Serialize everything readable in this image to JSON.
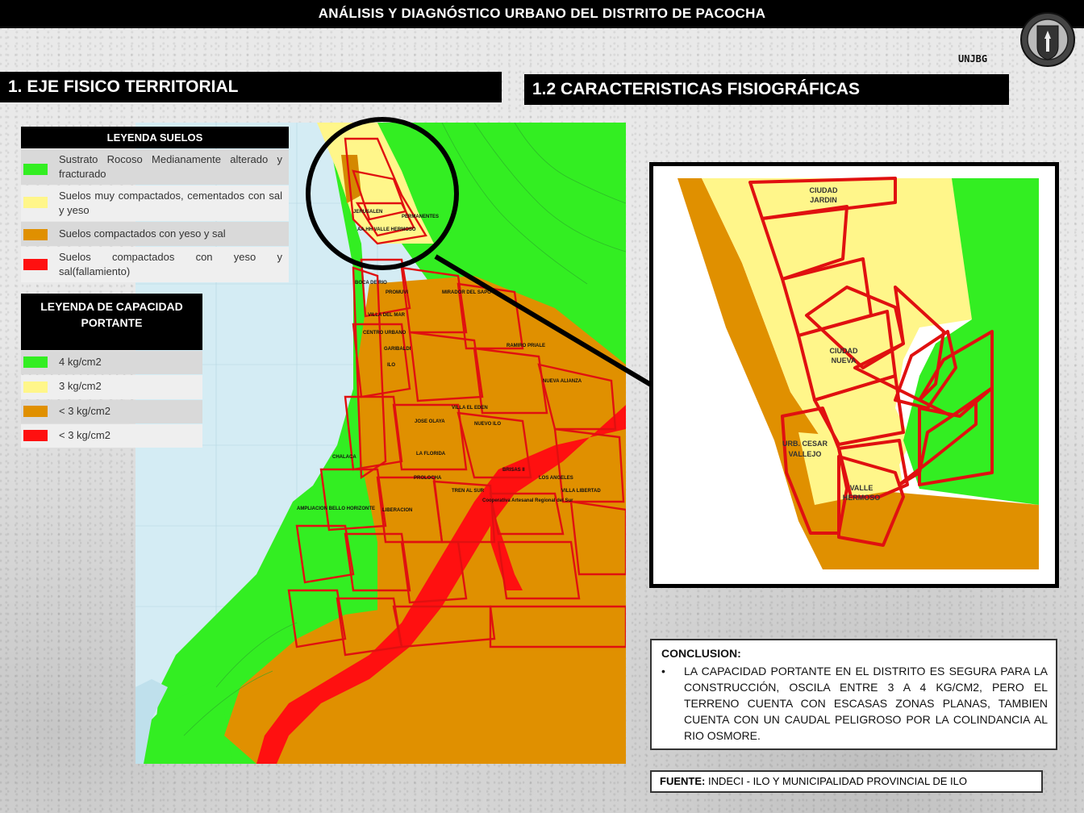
{
  "header": {
    "title": "ANÁLISIS Y DIAGNÓSTICO URBANO DEL DISTRITO DE PACOCHA"
  },
  "brand": {
    "unjbg": "UNJBG"
  },
  "sections": {
    "left_title": "1. EJE FISICO TERRITORIAL",
    "right_title": "1.2 CARACTERISTICAS FISIOGRÁFICAS"
  },
  "legend_suelos": {
    "title": "LEYENDA SUELOS",
    "items": [
      {
        "label": "Sustrato Rocoso Medianamente alterado y fracturado",
        "color": "#33ee22"
      },
      {
        "label": "Suelos muy compactados, cementados con sal y yeso",
        "color": "#fff68a"
      },
      {
        "label": "Suelos compactados con yeso y sal",
        "color": "#e09000"
      },
      {
        "label": "Suelos compactados con yeso y sal(fallamiento)",
        "color": "#ff1010"
      }
    ]
  },
  "legend_capacidad": {
    "title": "LEYENDA DE CAPACIDAD PORTANTE",
    "items": [
      {
        "label": "4 kg/cm2",
        "color": "#33ee22"
      },
      {
        "label": "3 kg/cm2",
        "color": "#fff68a"
      },
      {
        "label": "< 3 kg/cm2",
        "color": "#e09000"
      },
      {
        "label": "< 3 kg/cm2",
        "color": "#ff1010"
      }
    ]
  },
  "map_labels": [
    "JERUSALEN",
    "AA.HH VALLE HERMOSO",
    "PERMANENTES",
    "BOCA DE RIO",
    "PROMUVI",
    "VILLA DEL MAR",
    "CENTRO URBANO",
    "GARIBALDI",
    "ILO",
    "MIRADOR DEL SAPO",
    "RAMIRO PRIALE",
    "NUEVA ALIANZA",
    "VILLA EL EDEN",
    "NUEVO ILO",
    "JOSE OLAYA",
    "LA FLORIDA",
    "PROLOCHA",
    "CHALACA",
    "AMPLIACION BELLO HORIZONTE",
    "LIBERACION",
    "TREN AL SUR",
    "BRISAS II",
    "LOS ANGELES",
    "VILLA LIBERTAD",
    "Cooperativa Artesanal Regional del Sur"
  ],
  "inset": {
    "labels": {
      "ciudad_jardin": "CIUDAD JARDIN",
      "ciudad_nueva": "CIUDAD NUEVA",
      "cesar_vallejo": "URB. CESAR VALLEJO",
      "valle_hermoso": "VALLE HERMOSO"
    }
  },
  "conclusion": {
    "title": "CONCLUSION:",
    "bullet": "•",
    "text": "LA CAPACIDAD PORTANTE EN EL DISTRITO ES SEGURA PARA LA CONSTRUCCIÓN, OSCILA ENTRE 3 A 4 KG/CM2, PERO EL TERRENO CUENTA CON ESCASAS ZONAS PLANAS, TAMBIEN CUENTA CON UN CAUDAL PELIGROSO POR LA COLINDANCIA AL RIO OSMORE."
  },
  "source": {
    "label": "FUENTE:",
    "text": " INDECI - ILO Y MUNICIPALIDAD PROVINCIAL DE ILO"
  },
  "colors": {
    "green": "#33ee22",
    "yellow": "#fff68a",
    "orange": "#e09000",
    "red": "#ff1010",
    "sea": "#d4ecf4"
  }
}
